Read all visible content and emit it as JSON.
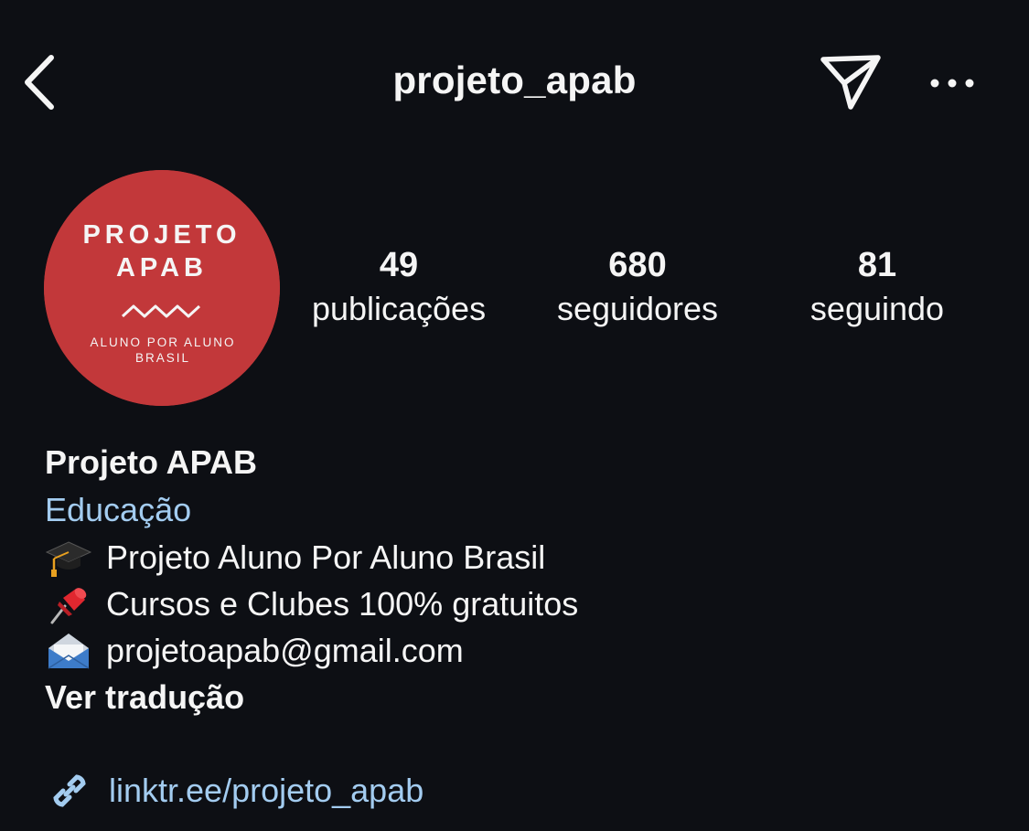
{
  "header": {
    "title": "projeto_apab",
    "back_icon": "chevron-left-icon",
    "send_icon": "paper-plane-icon",
    "more_icon": "more-horizontal-icon"
  },
  "avatar": {
    "line1": "PROJETO",
    "line2": "APAB",
    "line3": "ALUNO POR ALUNO",
    "line4": "BRASIL",
    "color": "#c2383a"
  },
  "stats": {
    "posts": {
      "value": "49",
      "label": "publicações"
    },
    "followers": {
      "value": "680",
      "label": "seguidores"
    },
    "following": {
      "value": "81",
      "label": "seguindo"
    }
  },
  "bio": {
    "name": "Projeto APAB",
    "category": "Educação",
    "lines": [
      {
        "icon": "graduation-cap-icon",
        "text": "Projeto Aluno Por Aluno Brasil"
      },
      {
        "icon": "pushpin-icon",
        "text": "Cursos e Clubes 100% gratuitos"
      },
      {
        "icon": "envelope-icon",
        "text": "projetoapab@gmail.com"
      }
    ],
    "translate_label": "Ver tradução"
  },
  "link": {
    "icon": "link-icon",
    "url": "linktr.ee/projeto_apab"
  },
  "colors": {
    "background": "#0d0f14",
    "text": "#f5f5f5",
    "accent_link": "#a3ccf0",
    "avatar_red": "#c2383a"
  }
}
